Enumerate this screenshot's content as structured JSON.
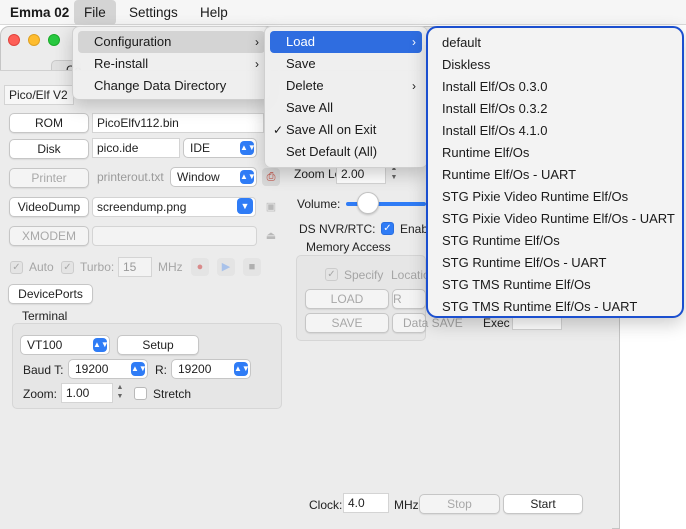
{
  "menubar": {
    "app": "Emma 02",
    "items": [
      "File",
      "Settings",
      "Help"
    ]
  },
  "window": {
    "tab_stub": "Co",
    "computer_select": "Pico/Elf V2",
    "rom": {
      "button": "ROM",
      "file": "PicoElfv112.bin"
    },
    "disk": {
      "button": "Disk",
      "file": "pico.ide",
      "type": "IDE"
    },
    "printer": {
      "button": "Printer",
      "file": "printerout.txt",
      "mode": "Window"
    },
    "videodump": {
      "button": "VideoDump",
      "file": "screendump.png"
    },
    "xmodem": {
      "button": "XMODEM"
    },
    "auto_label": "Auto",
    "turbo_label": "Turbo:",
    "turbo_value": "15",
    "turbo_unit": "MHz",
    "deviceports": "DevicePorts",
    "terminal": {
      "title": "Terminal",
      "type": "VT100",
      "setup": "Setup",
      "baud_t_label": "Baud T:",
      "baud_t": "19200",
      "baud_r_label": "R:",
      "baud_r": "19200",
      "zoom_label": "Zoom:",
      "zoom": "1.00",
      "stretch": "Stretch"
    },
    "zoom_level_label": "Zoom Level:",
    "zoom_level": "2.00",
    "volume_label": "Volume:",
    "volume_level": 0.15,
    "ds_nvr_label": "DS NVR/RTC:",
    "ds_nvr_check": "Enab",
    "memory_access": {
      "title": "Memory Access",
      "specify": "Specify",
      "location": "Locatio",
      "load": "LOAD",
      "save": "SAVE",
      "data_save": "Data SAVE",
      "r": "R",
      "exec": "Exec"
    },
    "clock_label": "Clock:",
    "clock_value": "4.0",
    "clock_unit": "MHz",
    "stop": "Stop",
    "start": "Start"
  },
  "file_menu": [
    {
      "label": "Configuration",
      "submenu": true,
      "highlighted": true
    },
    {
      "label": "Re-install",
      "submenu": true
    },
    {
      "label": "Change Data Directory",
      "submenu": false
    }
  ],
  "config_menu": [
    {
      "label": "Load",
      "submenu": true,
      "selected": true
    },
    {
      "label": "Save"
    },
    {
      "label": "Delete",
      "submenu": true
    },
    {
      "label": "Save All"
    },
    {
      "label": "Save All on Exit",
      "checked": true
    },
    {
      "label": "Set Default (All)"
    }
  ],
  "load_menu": [
    "default",
    "Diskless",
    "Install Elf/Os 0.3.0",
    "Install Elf/Os 0.3.2",
    "Install Elf/Os 4.1.0",
    "Runtime Elf/Os",
    "Runtime Elf/Os - UART",
    "STG Pixie Video Runtime Elf/Os",
    "STG Pixie Video Runtime Elf/Os - UART",
    "STG Runtime Elf/Os",
    "STG Runtime Elf/Os - UART",
    "STG TMS Runtime Elf/Os",
    "STG TMS Runtime Elf/Os - UART"
  ],
  "icons": {
    "submenu": "chevron-right-icon",
    "check": "checkmark-icon",
    "popup": "up-down-arrows-icon"
  },
  "colors": {
    "accent": "#2f7cf6",
    "selection": "#2f6de0",
    "outline": "#1b4fcf"
  }
}
